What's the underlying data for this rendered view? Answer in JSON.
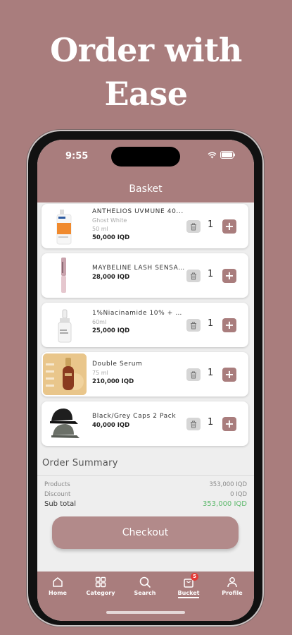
{
  "headline": {
    "line1": "Order with",
    "line2": "Ease"
  },
  "status_bar": {
    "time": "9:55"
  },
  "header": {
    "title": "Basket"
  },
  "items": [
    {
      "name": "ANTHELIOS UVMUNE 40...",
      "variant": "Ghost White",
      "size": "50 ml",
      "price": "50,000 IQD",
      "qty": "1",
      "image": "sunscreen-bottle-image"
    },
    {
      "name": "MAYBELINE LASH SENSA...",
      "variant": "",
      "size": "",
      "price": "28,000 IQD",
      "qty": "1",
      "image": "mascara-image"
    },
    {
      "name": "1%Niacinamide 10% + Zi...",
      "variant": "",
      "size": "60ml",
      "price": "25,000 IQD",
      "qty": "1",
      "image": "serum-dropper-image"
    },
    {
      "name": "Double Serum",
      "variant": "",
      "size": "75 ml",
      "price": "210,000 IQD",
      "qty": "1",
      "image": "double-serum-image"
    },
    {
      "name": "Black/Grey Caps 2 Pack",
      "variant": "",
      "size": "",
      "price": "40,000 IQD",
      "qty": "1",
      "image": "caps-image"
    }
  ],
  "summary": {
    "title": "Order Summary",
    "products_label": "Products",
    "products_value": "353,000 IQD",
    "discount_label": "Discount",
    "discount_value": "0 IQD",
    "subtotal_label": "Sub total",
    "subtotal_value": "353,000 IQD"
  },
  "checkout_label": "Checkout",
  "tabs": [
    {
      "label": "Home",
      "icon": "home-icon"
    },
    {
      "label": "Category",
      "icon": "grid-icon"
    },
    {
      "label": "Search",
      "icon": "search-icon"
    },
    {
      "label": "Bucket",
      "icon": "bag-icon",
      "badge": "5"
    },
    {
      "label": "Profile",
      "icon": "user-icon"
    }
  ],
  "colors": {
    "brand": "#a97d7d",
    "subtotal": "#5cb86b"
  }
}
